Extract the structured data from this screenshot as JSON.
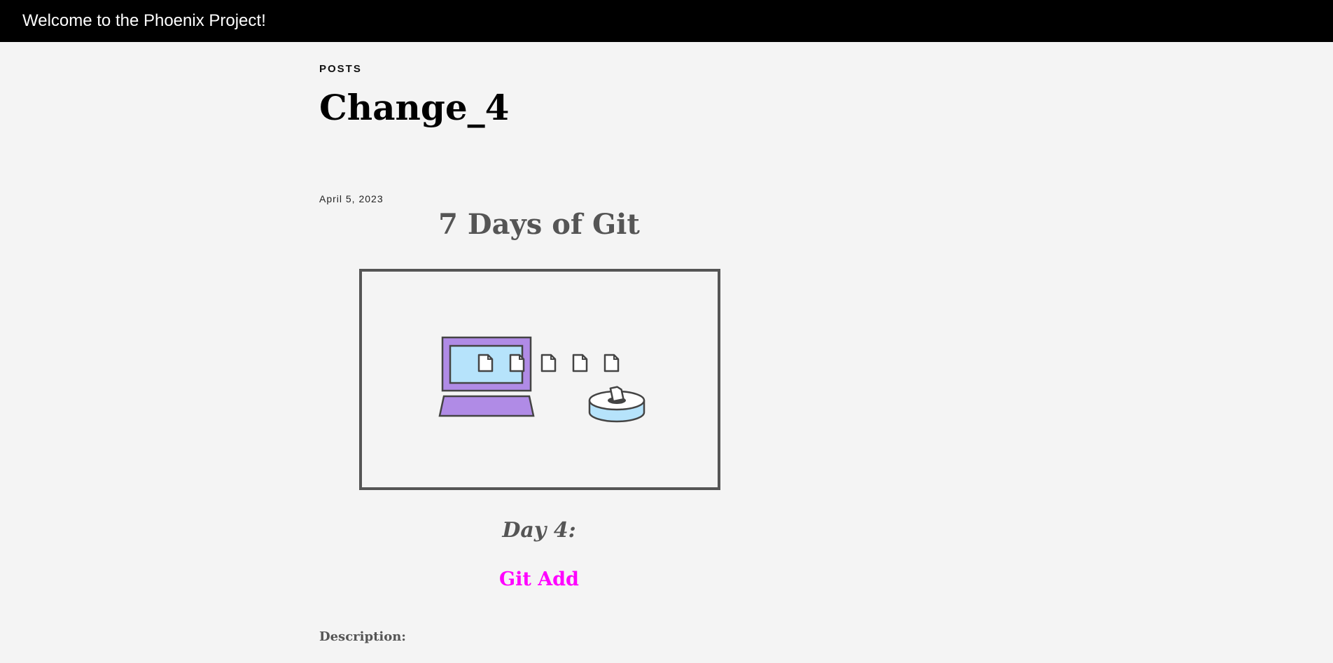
{
  "header": {
    "site_title": "Welcome to the Phoenix Project!"
  },
  "post": {
    "category": "POSTS",
    "title": "Change_4",
    "date": "April 5, 2023"
  },
  "article": {
    "series_title": "7 Days of Git",
    "figure_alt": "computer-files-to-staging-illustration",
    "day_label": "Day 4:",
    "topic_title": "Git Add",
    "description_label": "Description:"
  },
  "colors": {
    "header_bg": "#000000",
    "page_bg": "#f4f4f4",
    "accent": "#ff00ff",
    "laptop": "#b08be6",
    "screen": "#b6e3fb",
    "outline": "#444444"
  }
}
